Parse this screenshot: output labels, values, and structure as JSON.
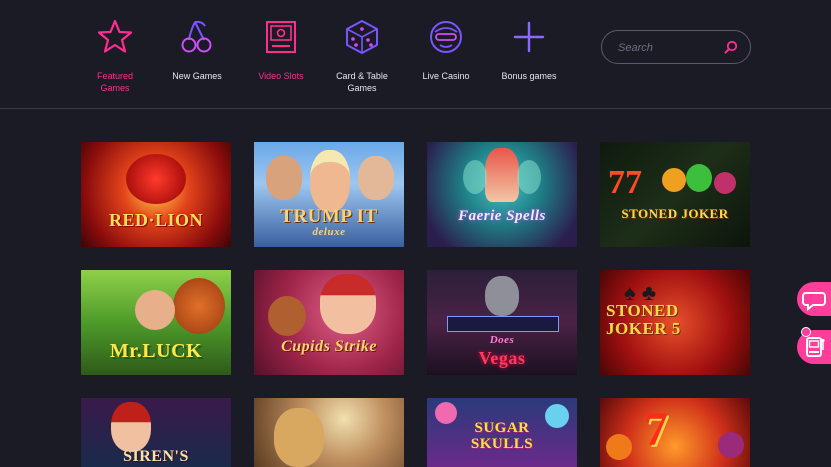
{
  "nav": {
    "categories": [
      {
        "label": "Featured\nGames",
        "icon": "star-icon"
      },
      {
        "label": "New Games",
        "icon": "cherries-icon"
      },
      {
        "label": "Video Slots",
        "icon": "slot-machine-icon"
      },
      {
        "label": "Card & Table\nGames",
        "icon": "dice-icon"
      },
      {
        "label": "Live Casino",
        "icon": "dealer-face-icon"
      },
      {
        "label": "Bonus games",
        "icon": "plus-icon"
      }
    ],
    "active_color": "#ff2e8e",
    "icon_color": "#6a4cff"
  },
  "search": {
    "placeholder": "Search"
  },
  "games": [
    {
      "title": "RED·LION"
    },
    {
      "title": "TRUMP IT",
      "subtitle": "deluxe"
    },
    {
      "title": "Faerie Spells"
    },
    {
      "title": "STONED JOKER"
    },
    {
      "title": "Mr.LUCK"
    },
    {
      "title": "Cupids Strike"
    },
    {
      "title": "Vegas",
      "subtitle": "Does"
    },
    {
      "title": "STONED\nJOKER 5"
    },
    {
      "title": "SIREN'S"
    },
    {
      "title": ""
    },
    {
      "title": "SUGAR\nSKULLS"
    },
    {
      "title": ""
    }
  ],
  "floating": {
    "chat_icon": "chat-bubble-icon",
    "slot_icon": "slot-machine-icon"
  }
}
